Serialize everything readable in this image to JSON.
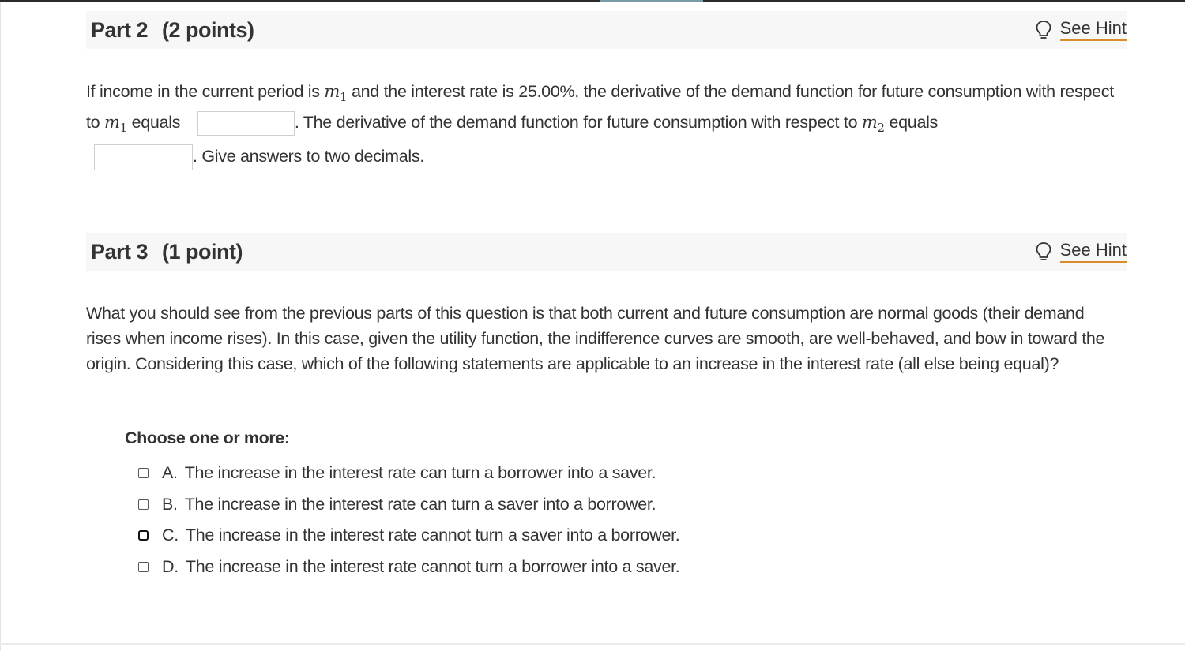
{
  "part2": {
    "title": "Part 2",
    "points": "(2 points)",
    "hint_label": "See Hint",
    "text_1": "If income in the current period is",
    "var_m1": "m",
    "sub_1": "1",
    "text_2": "and the interest rate is 25.00%, the derivative of the demand function for future consumption with respect to",
    "text_3": "equals",
    "text_4": ". The derivative of the demand function for future consumption with respect to",
    "var_m2": "m",
    "sub_2": "2",
    "text_5": "equals",
    "text_6": ". Give answers to two decimals.",
    "answer_1_value": "",
    "answer_2_value": ""
  },
  "part3": {
    "title": "Part 3",
    "points": "(1 point)",
    "hint_label": "See Hint",
    "question": "What you should see from the previous parts of this question is that both current and future consumption are normal goods (their demand rises when income rises). In this case, given the utility function, the indifference curves are smooth, are well-behaved, and bow in toward the origin. Considering this case, which of the following statements are applicable to an increase in the interest rate (all else being equal)?",
    "choose_label": "Choose one or more:",
    "choices": [
      {
        "letter": "A.",
        "text": "The increase in the interest rate can turn a borrower into a saver.",
        "checked": false
      },
      {
        "letter": "B.",
        "text": "The increase in the interest rate can turn a saver into a borrower.",
        "checked": false
      },
      {
        "letter": "C.",
        "text": "The increase in the interest rate cannot turn a saver into a borrower.",
        "checked": false
      },
      {
        "letter": "D.",
        "text": "The increase in the interest rate cannot turn a borrower into a saver.",
        "checked": false
      }
    ]
  },
  "colors": {
    "hint_underline": "#d98c2b",
    "header_bg": "#f7f7f7",
    "text": "#333333"
  },
  "icons": {
    "hint": "lightbulb-icon"
  }
}
